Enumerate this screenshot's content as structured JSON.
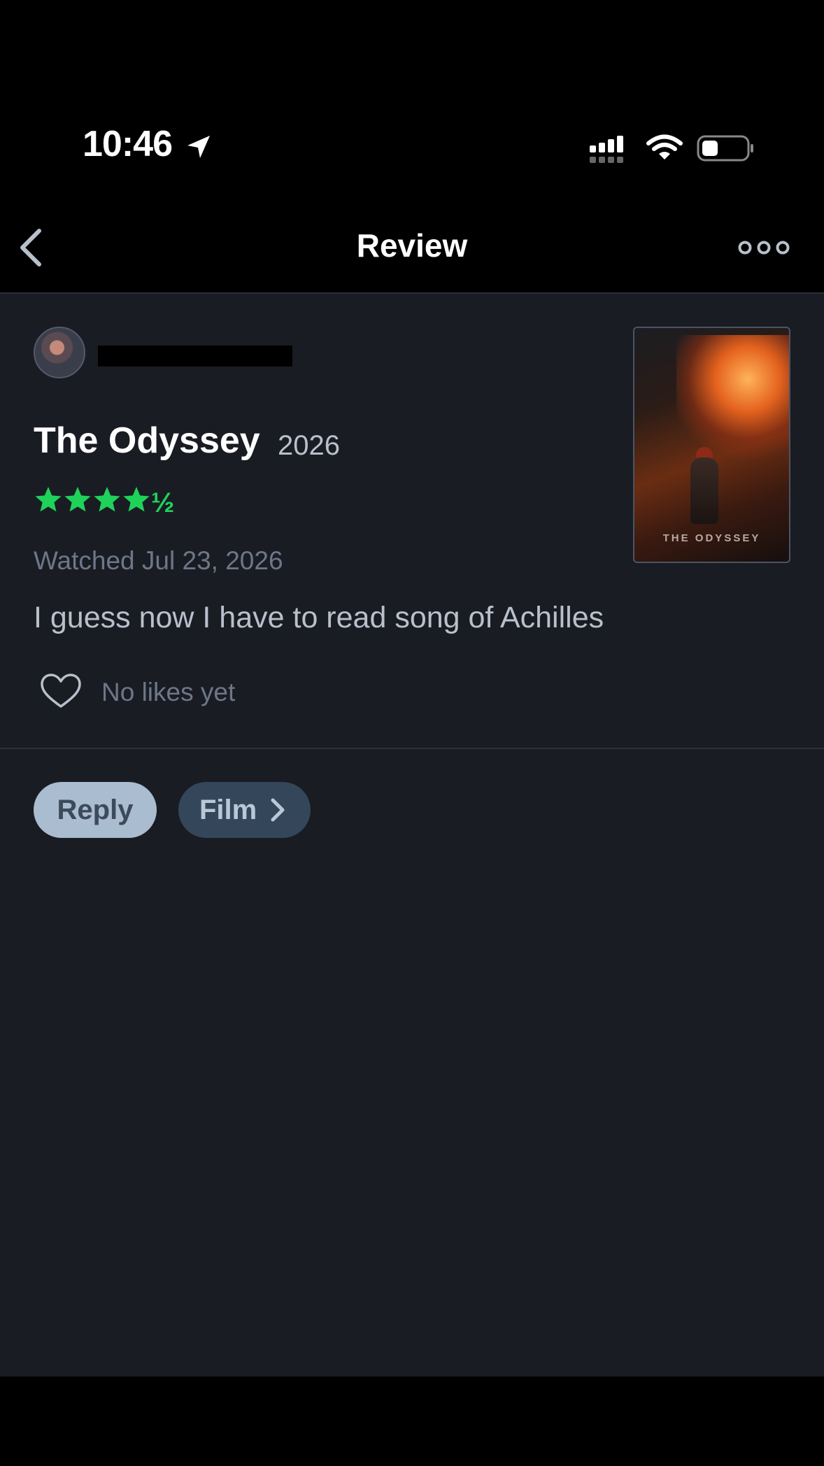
{
  "status_bar": {
    "time": "10:46"
  },
  "nav": {
    "title": "Review"
  },
  "review": {
    "film_title": "The Odyssey",
    "film_year": "2026",
    "rating_stars": 4.5,
    "rating_half_glyph": "½",
    "watched": "Watched Jul 23, 2026",
    "text": "I guess now I have to read song of Achilles",
    "likes": "No likes yet"
  },
  "poster": {
    "title": "THE ODYSSEY"
  },
  "actions": {
    "reply_label": "Reply",
    "film_label": "Film"
  },
  "colors": {
    "background": "#1a1c23",
    "star_green": "#1fd25a",
    "reply_bg": "#aabccf",
    "film_bg": "#34475a"
  },
  "icons": [
    "location-arrow-icon",
    "signal-icon",
    "wifi-icon",
    "battery-icon",
    "back-chevron-icon",
    "more-icon",
    "star-icon",
    "heart-icon",
    "chevron-right-icon"
  ]
}
